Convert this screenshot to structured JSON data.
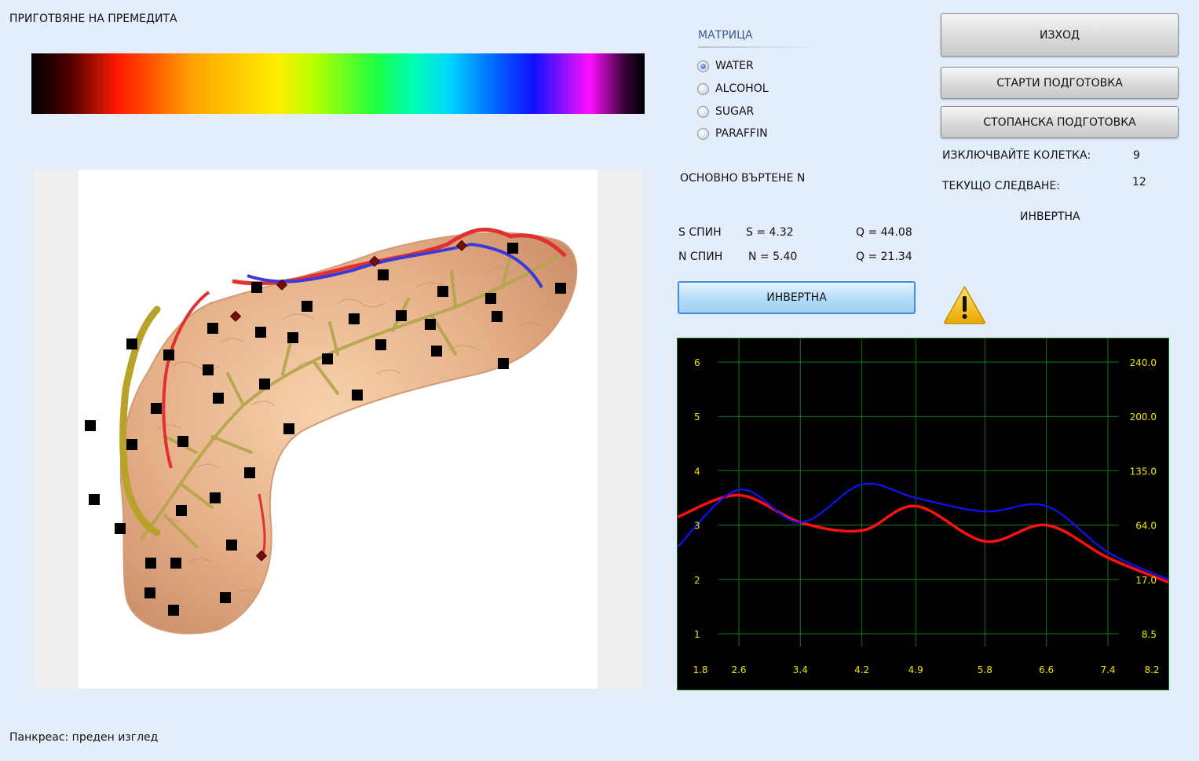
{
  "app": {
    "title": "ПРИГОТВЯНЕ НА ПРЕМЕДИТА"
  },
  "viewer": {
    "caption": "Панкреас: преден изглед"
  },
  "matrix": {
    "title": "МАТРИЦА",
    "options": [
      {
        "label": "WATER",
        "selected": true
      },
      {
        "label": "ALCOHOL",
        "selected": false
      },
      {
        "label": "SUGAR",
        "selected": false
      },
      {
        "label": "PARAFFIN",
        "selected": false
      }
    ]
  },
  "rotation": {
    "label": "ОСНОВНО ВЪРТЕНЕ N"
  },
  "spins": {
    "s": {
      "label": "S СПИН",
      "value": "S = 4.32",
      "q": "Q = 44.08"
    },
    "n": {
      "label": "N СПИН",
      "value": "N = 5.40",
      "q": "Q = 21.34"
    }
  },
  "invert_button": {
    "label": "ИНВЕРТНА"
  },
  "buttons": {
    "exit": "ИЗХОД",
    "start": "СТАРТИ ПОДГОТОВКА",
    "farm": "СТОПАНСКА ПОДГОТОВКА"
  },
  "stats": {
    "exclude_label": "ИЗКЛЮЧВАЙТЕ КОЛЕТКА:",
    "exclude_value": "9",
    "current_label": "ТЕКУЩО СЛЕДВАНЕ:",
    "current_value": "12",
    "mode": "ИНВЕРТНА"
  },
  "colors": {
    "accent_blue": "#3e8ede",
    "grid": "#0f7a18",
    "tick_text": "#f2e400",
    "series_red": "#ff1010",
    "series_blue": "#1010ff",
    "warning": "#f5c000"
  },
  "icons": {
    "warning": "warning-triangle-icon"
  },
  "chart_data": {
    "type": "line",
    "x_ticks": [
      "1.8",
      "2.6",
      "3.4",
      "4.2",
      "4.9",
      "5.8",
      "6.6",
      "7.4",
      "8.2"
    ],
    "y_left_ticks": [
      "1",
      "2",
      "3",
      "4",
      "5",
      "6"
    ],
    "y_right_ticks": [
      "8.5",
      "17.0",
      "64.0",
      "135.0",
      "200.0",
      "240.0"
    ],
    "ylim": [
      0.5,
      6.5
    ],
    "grid": true,
    "series": [
      {
        "color": "#ff1010",
        "x": [
          1.8,
          2.6,
          3.4,
          4.2,
          4.9,
          5.8,
          6.6,
          7.4,
          8.2
        ],
        "values": [
          3.15,
          3.55,
          3.05,
          2.9,
          3.35,
          2.7,
          3.0,
          2.4,
          1.95
        ]
      },
      {
        "color": "#1010ff",
        "x": [
          1.8,
          2.6,
          3.4,
          4.2,
          4.9,
          5.8,
          6.6,
          7.4,
          8.2
        ],
        "values": [
          2.6,
          3.65,
          3.05,
          3.75,
          3.5,
          3.25,
          3.35,
          2.5,
          2.0
        ]
      }
    ]
  }
}
